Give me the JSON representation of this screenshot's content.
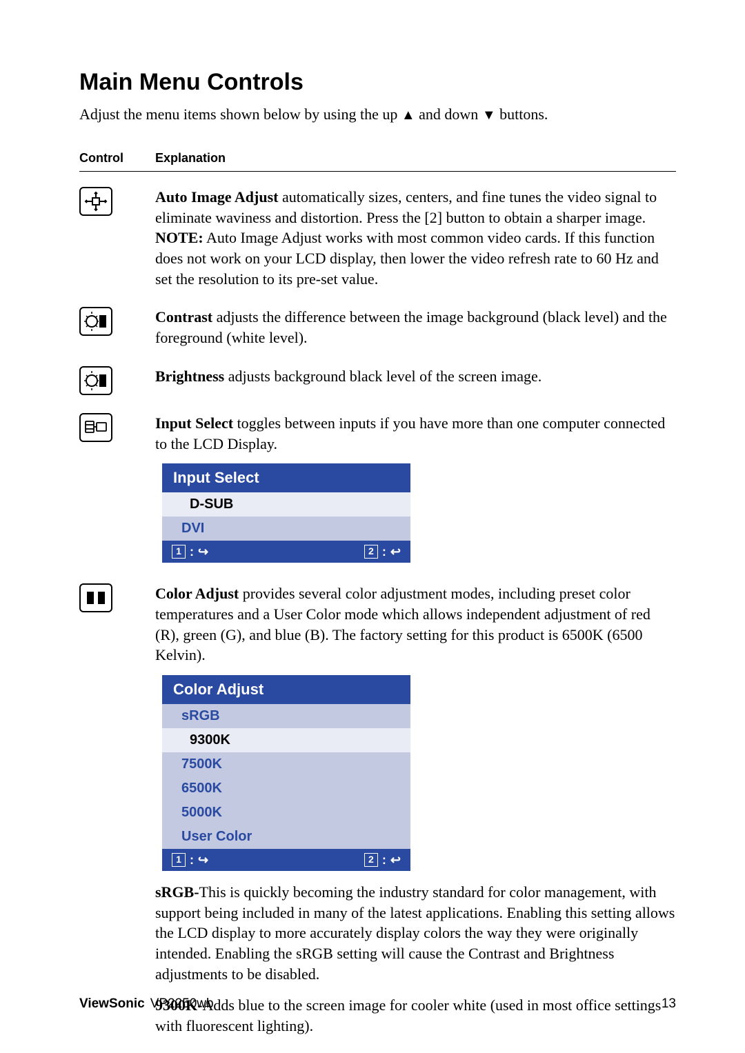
{
  "title": "Main Menu Controls",
  "intro_pre": "Adjust the menu items shown below by using the up ",
  "intro_mid": " and down ",
  "intro_post": " buttons.",
  "header": {
    "control": "Control",
    "explanation": "Explanation"
  },
  "auto": {
    "b": "Auto Image Adjust",
    "text": " automatically sizes, centers, and fine tunes the video signal to eliminate waviness and distortion. Press the [2] button to obtain a sharper image.",
    "note_b": "NOTE:",
    "note": " Auto Image Adjust works with most common video cards. If this function does not work on your LCD display, then lower the video refresh rate to 60 Hz and set the resolution to its pre-set value."
  },
  "contrast": {
    "b": "Contrast",
    "text": " adjusts the difference between the image background  (black level) and the foreground (white level)."
  },
  "brightness": {
    "b": "Brightness",
    "text": " adjusts background black level of the screen image."
  },
  "input": {
    "b": "Input Select",
    "text": " toggles between inputs if you have more than one computer connected to the LCD Display.",
    "osd_title": "Input Select",
    "options": [
      "D-SUB",
      "DVI"
    ],
    "selected": 0,
    "foot1": "1",
    "foot2": "2"
  },
  "color": {
    "b": "Color Adjust",
    "text": " provides several color adjustment modes, including preset color temperatures and a User Color mode which allows independent adjustment of red (R), green (G), and blue (B). The factory setting for this product is 6500K (6500 Kelvin).",
    "osd_title": "Color Adjust",
    "options": [
      "sRGB",
      "9300K",
      "7500K",
      "6500K",
      "5000K",
      "User Color"
    ],
    "selected": 1,
    "foot1": "1",
    "foot2": "2"
  },
  "srgb": {
    "b": "sRGB-",
    "text": "This is quickly becoming the industry standard for color management, with support being included in many of the latest applications. Enabling this setting allows the LCD display to more accurately display colors the way they were originally intended. Enabling the sRGB setting will cause the Contrast and Brightness adjustments to be disabled."
  },
  "k9300": {
    "b": "9300K-",
    "text": "Adds blue to the screen image for cooler white (used in most office settings with fluorescent lighting)."
  },
  "footer": {
    "brand": "ViewSonic",
    "model": "VP2250wb",
    "page": "13"
  }
}
